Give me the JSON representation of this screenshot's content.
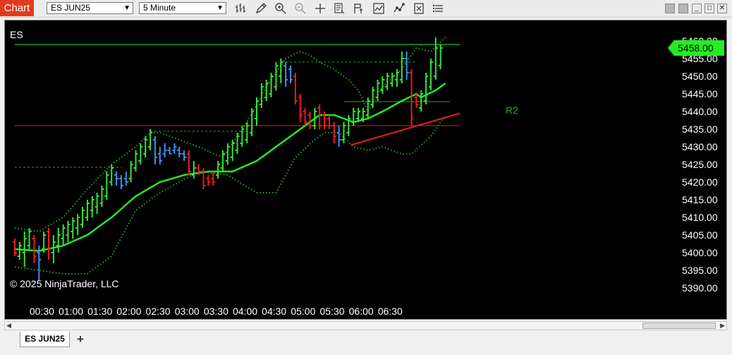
{
  "window": {
    "title_tab": "Chart",
    "instrument_select": "ES JUN25",
    "interval_select": "5 Minute"
  },
  "toolbar": {
    "icons": [
      "bar-type-icon",
      "drawing-tool-icon",
      "zoom-in-icon",
      "zoom-out-icon",
      "crosshair-icon",
      "data-box-icon",
      "chart-trader-icon",
      "indicators-icon",
      "strategies-icon",
      "properties-icon",
      "menu-icon"
    ]
  },
  "chart": {
    "instrument_label": "ES",
    "copyright": "© 2025 NinjaTrader, LLC",
    "last_price": "5458.00",
    "pivot_label": "R2",
    "colors": {
      "up": "#33e633",
      "down": "#ee1c1c",
      "neutral": "#3d8ef0",
      "sma": "#22ee22",
      "bands": "#1fa81f",
      "background": "#000000",
      "price_badge": "#22ee22"
    }
  },
  "chart_data": {
    "type": "bar",
    "subtype": "ohlc-bars",
    "ylim": [
      5387,
      5463
    ],
    "y_ticks": [
      "5460.00",
      "5455.00",
      "5450.00",
      "5445.00",
      "5440.00",
      "5435.00",
      "5430.00",
      "5425.00",
      "5420.00",
      "5415.00",
      "5410.00",
      "5405.00",
      "5400.00",
      "5395.00",
      "5390.00"
    ],
    "x_ticks": [
      "00:30",
      "01:00",
      "01:30",
      "02:00",
      "02:30",
      "03:00",
      "03:30",
      "04:00",
      "04:30",
      "05:00",
      "05:30",
      "06:00",
      "06:30"
    ],
    "x_start": "00:02",
    "bar_interval_minutes": 5,
    "bars": [
      [
        "down",
        5404,
        5399,
        5403,
        5400
      ],
      [
        "up",
        5403,
        5398,
        5399,
        5402
      ],
      [
        "up",
        5406,
        5396,
        5400,
        5404
      ],
      [
        "up",
        5407,
        5401,
        5402,
        5406
      ],
      [
        "down",
        5405,
        5397,
        5404,
        5399
      ],
      [
        "neutral",
        5402,
        5392,
        5400,
        5398
      ],
      [
        "up",
        5406,
        5400,
        5401,
        5405
      ],
      [
        "down",
        5407,
        5398,
        5406,
        5401
      ],
      [
        "up",
        5405,
        5397,
        5400,
        5403
      ],
      [
        "up",
        5407,
        5400,
        5402,
        5405
      ],
      [
        "up",
        5408,
        5402,
        5404,
        5407
      ],
      [
        "up",
        5409,
        5403,
        5405,
        5408
      ],
      [
        "up",
        5410,
        5404,
        5406,
        5409
      ],
      [
        "up",
        5411,
        5405,
        5407,
        5410
      ],
      [
        "up",
        5413,
        5407,
        5408,
        5412
      ],
      [
        "up",
        5415,
        5409,
        5410,
        5414
      ],
      [
        "up",
        5416,
        5410,
        5412,
        5415
      ],
      [
        "up",
        5417,
        5411,
        5413,
        5416
      ],
      [
        "up",
        5419,
        5413,
        5414,
        5418
      ],
      [
        "up",
        5423,
        5415,
        5416,
        5422
      ],
      [
        "up",
        5425,
        5419,
        5420,
        5424
      ],
      [
        "neutral",
        5423,
        5419,
        5422,
        5421
      ],
      [
        "neutral",
        5422,
        5418,
        5421,
        5419
      ],
      [
        "neutral",
        5423,
        5419,
        5421,
        5420
      ],
      [
        "up",
        5426,
        5420,
        5421,
        5425
      ],
      [
        "up",
        5429,
        5423,
        5424,
        5428
      ],
      [
        "up",
        5431,
        5425,
        5426,
        5430
      ],
      [
        "up",
        5433,
        5427,
        5428,
        5432
      ],
      [
        "up",
        5435,
        5429,
        5430,
        5434
      ],
      [
        "neutral",
        5433,
        5425,
        5432,
        5427
      ],
      [
        "neutral",
        5430,
        5425,
        5428,
        5426
      ],
      [
        "neutral",
        5431,
        5427,
        5428,
        5429
      ],
      [
        "neutral",
        5430,
        5428,
        5429,
        5428
      ],
      [
        "neutral",
        5431,
        5428,
        5429,
        5430
      ],
      [
        "neutral",
        5430,
        5427,
        5429,
        5428
      ],
      [
        "neutral",
        5429,
        5426,
        5428,
        5427
      ],
      [
        "down",
        5429,
        5422,
        5428,
        5423
      ],
      [
        "up",
        5426,
        5421,
        5422,
        5424
      ],
      [
        "down",
        5425,
        5422,
        5424,
        5423
      ],
      [
        "down",
        5424,
        5418,
        5423,
        5419
      ],
      [
        "down",
        5422,
        5419,
        5421,
        5420
      ],
      [
        "down",
        5423,
        5419,
        5421,
        5420
      ],
      [
        "up",
        5426,
        5421,
        5422,
        5425
      ],
      [
        "up",
        5429,
        5423,
        5424,
        5428
      ],
      [
        "up",
        5431,
        5425,
        5426,
        5430
      ],
      [
        "up",
        5432,
        5426,
        5427,
        5431
      ],
      [
        "up",
        5434,
        5428,
        5429,
        5433
      ],
      [
        "up",
        5436,
        5430,
        5431,
        5435
      ],
      [
        "up",
        5437,
        5431,
        5432,
        5436
      ],
      [
        "up",
        5441,
        5433,
        5434,
        5440
      ],
      [
        "up",
        5444,
        5436,
        5438,
        5443
      ],
      [
        "up",
        5448,
        5441,
        5442,
        5447
      ],
      [
        "up",
        5449,
        5443,
        5444,
        5448
      ],
      [
        "up",
        5451,
        5444,
        5445,
        5450
      ],
      [
        "up",
        5454,
        5446,
        5447,
        5453
      ],
      [
        "up",
        5455,
        5448,
        5450,
        5454
      ],
      [
        "neutral",
        5454,
        5447,
        5453,
        5449
      ],
      [
        "neutral",
        5453,
        5448,
        5452,
        5449
      ],
      [
        "down",
        5451,
        5442,
        5450,
        5443
      ],
      [
        "down",
        5445,
        5437,
        5444,
        5439
      ],
      [
        "down",
        5441,
        5436,
        5440,
        5437
      ],
      [
        "down",
        5440,
        5435,
        5439,
        5436
      ],
      [
        "up",
        5441,
        5435,
        5436,
        5440
      ],
      [
        "down",
        5442,
        5435,
        5441,
        5436
      ],
      [
        "down",
        5440,
        5435,
        5439,
        5436
      ],
      [
        "down",
        5439,
        5435,
        5438,
        5436
      ],
      [
        "down",
        5437,
        5431,
        5436,
        5433
      ],
      [
        "neutral",
        5436,
        5430,
        5434,
        5432
      ],
      [
        "up",
        5437,
        5431,
        5432,
        5436
      ],
      [
        "up",
        5439,
        5433,
        5434,
        5438
      ],
      [
        "up",
        5441,
        5436,
        5437,
        5440
      ],
      [
        "up",
        5441,
        5437,
        5438,
        5440
      ],
      [
        "up",
        5441,
        5437,
        5438,
        5440
      ],
      [
        "up",
        5444,
        5438,
        5439,
        5443
      ],
      [
        "up",
        5447,
        5441,
        5442,
        5446
      ],
      [
        "up",
        5449,
        5443,
        5444,
        5448
      ],
      [
        "up",
        5450,
        5445,
        5446,
        5449
      ],
      [
        "up",
        5451,
        5446,
        5447,
        5450
      ],
      [
        "up",
        5451,
        5447,
        5448,
        5450
      ],
      [
        "up",
        5452,
        5447,
        5449,
        5451
      ],
      [
        "up",
        5457,
        5448,
        5449,
        5455
      ],
      [
        "neutral",
        5457,
        5449,
        5455,
        5451
      ],
      [
        "down",
        5452,
        5436,
        5451,
        5438
      ],
      [
        "down",
        5445,
        5441,
        5444,
        5442
      ],
      [
        "up",
        5446,
        5440,
        5441,
        5445
      ],
      [
        "up",
        5451,
        5442,
        5443,
        5450
      ],
      [
        "up",
        5455,
        5446,
        5447,
        5454
      ],
      [
        "up",
        5461,
        5449,
        5450,
        5458
      ],
      [
        "up",
        5459,
        5452,
        5453,
        5458
      ]
    ],
    "sma": [
      [
        0,
        5401
      ],
      [
        5,
        5400.5
      ],
      [
        10,
        5402
      ],
      [
        15,
        5405
      ],
      [
        20,
        5410
      ],
      [
        25,
        5416
      ],
      [
        30,
        5420
      ],
      [
        35,
        5422
      ],
      [
        40,
        5423
      ],
      [
        45,
        5423
      ],
      [
        50,
        5426
      ],
      [
        55,
        5431
      ],
      [
        60,
        5436
      ],
      [
        63,
        5439
      ],
      [
        66,
        5439
      ],
      [
        70,
        5437
      ],
      [
        73,
        5438
      ],
      [
        76,
        5440
      ],
      [
        80,
        5443
      ],
      [
        83,
        5445
      ],
      [
        84,
        5444
      ],
      [
        87,
        5446
      ],
      [
        89,
        5448
      ]
    ],
    "upper_band": [
      [
        0,
        5407
      ],
      [
        5,
        5406
      ],
      [
        10,
        5410
      ],
      [
        15,
        5418
      ],
      [
        20,
        5425
      ],
      [
        25,
        5430
      ],
      [
        28,
        5434
      ],
      [
        30,
        5434
      ],
      [
        38,
        5430
      ],
      [
        43,
        5427
      ],
      [
        48,
        5437
      ],
      [
        52,
        5447
      ],
      [
        56,
        5455
      ],
      [
        59,
        5457
      ],
      [
        61,
        5456
      ],
      [
        63,
        5454
      ],
      [
        66,
        5452
      ],
      [
        69,
        5449
      ],
      [
        71,
        5446
      ],
      [
        73,
        5440
      ],
      [
        76,
        5447
      ],
      [
        80,
        5452
      ],
      [
        83,
        5458
      ],
      [
        86,
        5457
      ],
      [
        89,
        5461
      ]
    ],
    "lower_band": [
      [
        0,
        5396
      ],
      [
        5,
        5395
      ],
      [
        10,
        5394
      ],
      [
        15,
        5394
      ],
      [
        20,
        5399
      ],
      [
        25,
        5412
      ],
      [
        30,
        5417
      ],
      [
        34,
        5420
      ],
      [
        38,
        5423
      ],
      [
        44,
        5422
      ],
      [
        50,
        5417
      ],
      [
        54,
        5417
      ],
      [
        58,
        5427
      ],
      [
        62,
        5432
      ],
      [
        64,
        5434
      ],
      [
        67,
        5434
      ],
      [
        70,
        5430
      ],
      [
        73,
        5429
      ],
      [
        76,
        5430
      ],
      [
        80,
        5428
      ],
      [
        82,
        5428
      ],
      [
        86,
        5433
      ],
      [
        89,
        5439
      ]
    ],
    "levels": [
      {
        "price": 5459,
        "color": "#22ee22",
        "dash": false,
        "from_bar": 0,
        "to_bar": 92
      },
      {
        "price": 5436,
        "color": "#ee1c1c",
        "dash": false,
        "from_bar": 0,
        "to_bar": 92
      },
      {
        "price": 5424.2,
        "color": "#1fa81f",
        "dash": true,
        "from_bar": 0,
        "to_bar": 22
      },
      {
        "price": 5434.4,
        "color": "#1fa81f",
        "dash": true,
        "from_bar": 28,
        "to_bar": 48
      },
      {
        "price": 5454,
        "color": "#1fa81f",
        "dash": true,
        "from_bar": 56,
        "to_bar": 83
      },
      {
        "price": 5442.8,
        "color": "#1fa81f",
        "dash": false,
        "from_bar": 68,
        "to_bar": 90
      }
    ],
    "trendline": [
      [
        69.5,
        5430.5
      ],
      [
        92,
        5439.5
      ]
    ]
  }
}
